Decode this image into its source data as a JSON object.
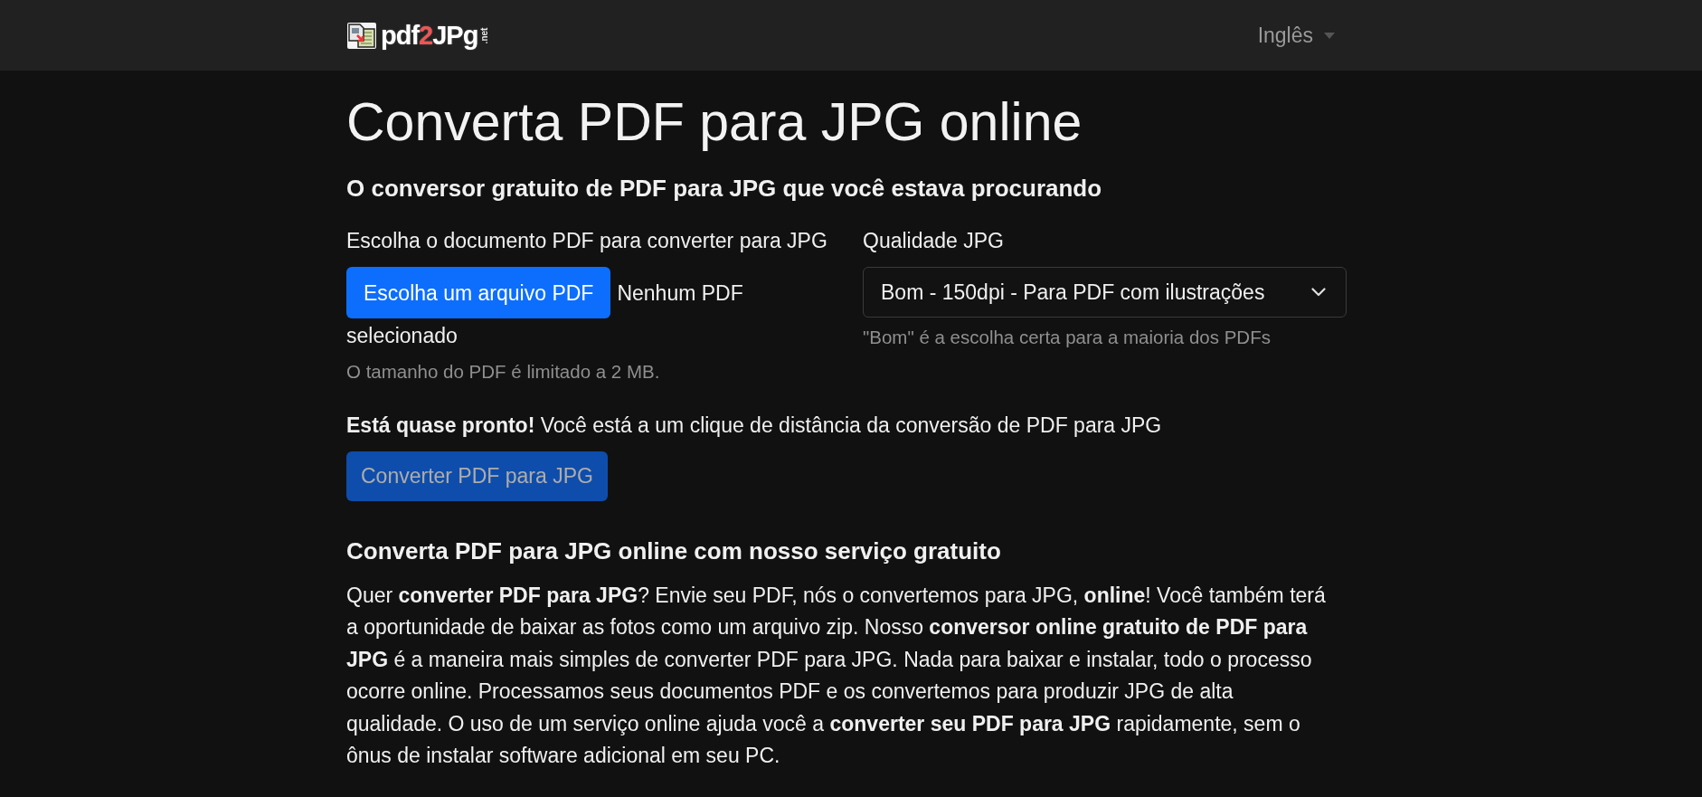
{
  "header": {
    "logo": {
      "parts": [
        {
          "text": "pdf",
          "color": "#ffffff"
        },
        {
          "text": "2",
          "color": "#f05555"
        },
        {
          "text": "JPg",
          "color": "#ffffff"
        }
      ],
      "suffix": ".net"
    },
    "language": {
      "label": "Inglês"
    }
  },
  "title": "Converta PDF para JPG online",
  "subtitle": "O conversor gratuito de PDF para JPG que você estava procurando",
  "file_field": {
    "label": "Escolha o documento PDF para converter para JPG",
    "button": "Escolha um arquivo PDF",
    "status": "Nenhum PDF selecionado",
    "help": "O tamanho do PDF é limitado a 2 MB."
  },
  "quality_field": {
    "label": "Qualidade JPG",
    "value": "Bom - 150dpi - Para PDF com ilustrações",
    "help": "\"Bom\" é a escolha certa para a maioria dos PDFs"
  },
  "ready_message": "**Está quase pronto!** Você está a um clique de distância da conversão de PDF para JPG",
  "convert_button": {
    "label": "Converter PDF para JPG",
    "disabled": true
  },
  "section": {
    "heading": "Converta PDF para JPG online com nosso serviço gratuito",
    "paragraph": "Quer **converter PDF para JPG**? Envie seu PDF, nós o convertemos para JPG, **online**! Você também terá a oportunidade de baixar as fotos como um arquivo zip. Nosso **conversor online gratuito de PDF para JPG** é a maneira mais simples de converter PDF para JPG. Nada para baixar e instalar, todo o processo ocorre online. Processamos seus documentos PDF e os convertemos para produzir JPG de alta qualidade. O uso de um serviço online ajuda você a **converter seu PDF para JPG** rapidamente, sem o ônus de instalar software adicional em seu PC."
  }
}
